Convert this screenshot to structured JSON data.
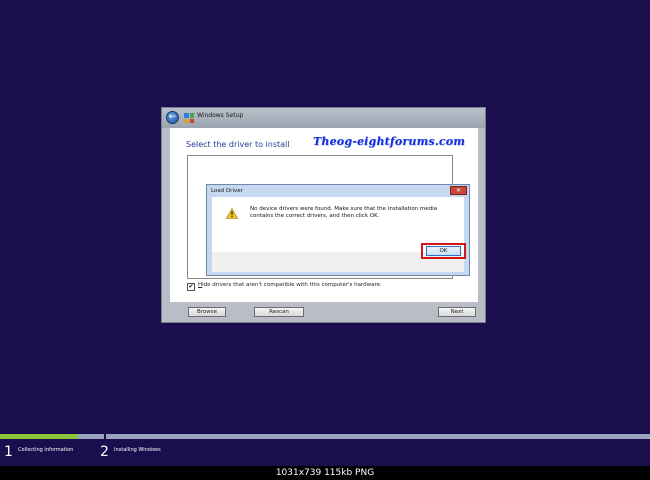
{
  "window": {
    "title": "Windows Setup",
    "heading": "Select the driver to install",
    "watermark": "Theog-eightforums.com",
    "hide_checkbox_checked": true,
    "hide_label_hotkey": "H",
    "hide_label_rest": "ide drivers that aren't compatible with this computer's hardware.",
    "browse_label": "Browse",
    "rescan_label": "Rescan",
    "next_label": "Next"
  },
  "dialog": {
    "title": "Load Driver",
    "message": "No device drivers were found. Make sure that the installation media contains the correct drivers, and then click OK.",
    "ok_label": "OK",
    "icon": "warning-icon"
  },
  "progress": {
    "completed_fraction": 0.12,
    "steps": [
      {
        "number": "1",
        "label": "Collecting information"
      },
      {
        "number": "2",
        "label": "Installing Windows"
      }
    ]
  },
  "caption": "1031x739  115kb  PNG",
  "colors": {
    "background": "#1b0e4f",
    "progress_done": "#8cc63f",
    "highlight": "#d01818"
  }
}
